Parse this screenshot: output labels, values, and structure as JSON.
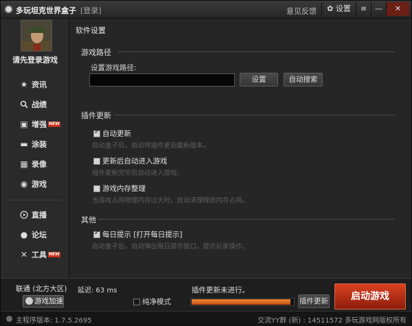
{
  "titlebar": {
    "app_title": "多玩坦克世界盒子",
    "login_link": "[登录]",
    "feedback": "意见反馈",
    "settings_label": "设置",
    "dropdown_icon": "menu-icon",
    "min_glyph": "—",
    "close_glyph": "✕"
  },
  "sidebar": {
    "login_hint": "请先登录游戏",
    "items": [
      {
        "label": "资讯",
        "icon": "star-icon",
        "glyph": "★"
      },
      {
        "label": "战绩",
        "icon": "search-icon",
        "glyph": "🔍"
      },
      {
        "label": "增强",
        "icon": "toolbox-icon",
        "glyph": "▣",
        "badge": "NEW"
      },
      {
        "label": "涂装",
        "icon": "tank-icon",
        "glyph": "▬"
      },
      {
        "label": "录像",
        "icon": "film-icon",
        "glyph": "▦"
      },
      {
        "label": "游戏",
        "icon": "gamepad-icon",
        "glyph": "◉"
      },
      {
        "label": "直播",
        "icon": "play-icon",
        "glyph": "▶"
      },
      {
        "label": "论坛",
        "icon": "chat-icon",
        "glyph": "●"
      },
      {
        "label": "工具",
        "icon": "tools-icon",
        "glyph": "✕",
        "badge": "NEW"
      }
    ]
  },
  "main": {
    "title": "软件设置",
    "game_path": {
      "heading": "游戏路径",
      "label": "设置游戏路径:",
      "value": "",
      "set_button": "设置",
      "auto_search_button": "自动搜索"
    },
    "plugin_update": {
      "heading": "插件更新",
      "options": [
        {
          "label": "自动更新",
          "checked": true,
          "desc": "启动盒子后，自动将插件更到最新版本。"
        },
        {
          "label": "更新后自动进入游戏",
          "checked": false,
          "desc": "插件更新完毕后自动进入游戏。"
        },
        {
          "label": "游戏内存整理",
          "checked": false,
          "desc": "当游戏占用物理内存过大时，自动清理释放内存占用。"
        }
      ]
    },
    "other": {
      "heading": "其他",
      "options": [
        {
          "label": "每日提示 [打开每日提示]",
          "checked": true,
          "desc": "启动盒子后，自动弹出每日提示窗口，提示玩家操作。"
        }
      ]
    }
  },
  "bottom": {
    "server": "联通 (北方大区)",
    "latency": "延迟: 63 ms",
    "accel_button": "游戏加速",
    "pure_mode_label": "纯净模式",
    "pure_mode_checked": false,
    "update_status": "插件更新未进行。",
    "progress_fraction": 0.97,
    "plugin_update_button": "插件更新",
    "launch_button": "启动游戏"
  },
  "statusbar": {
    "version": "主程序版本: 1.7.5.2695",
    "right": "交流YY群 (新) : 14511572  多玩游戏网版权所有"
  }
}
